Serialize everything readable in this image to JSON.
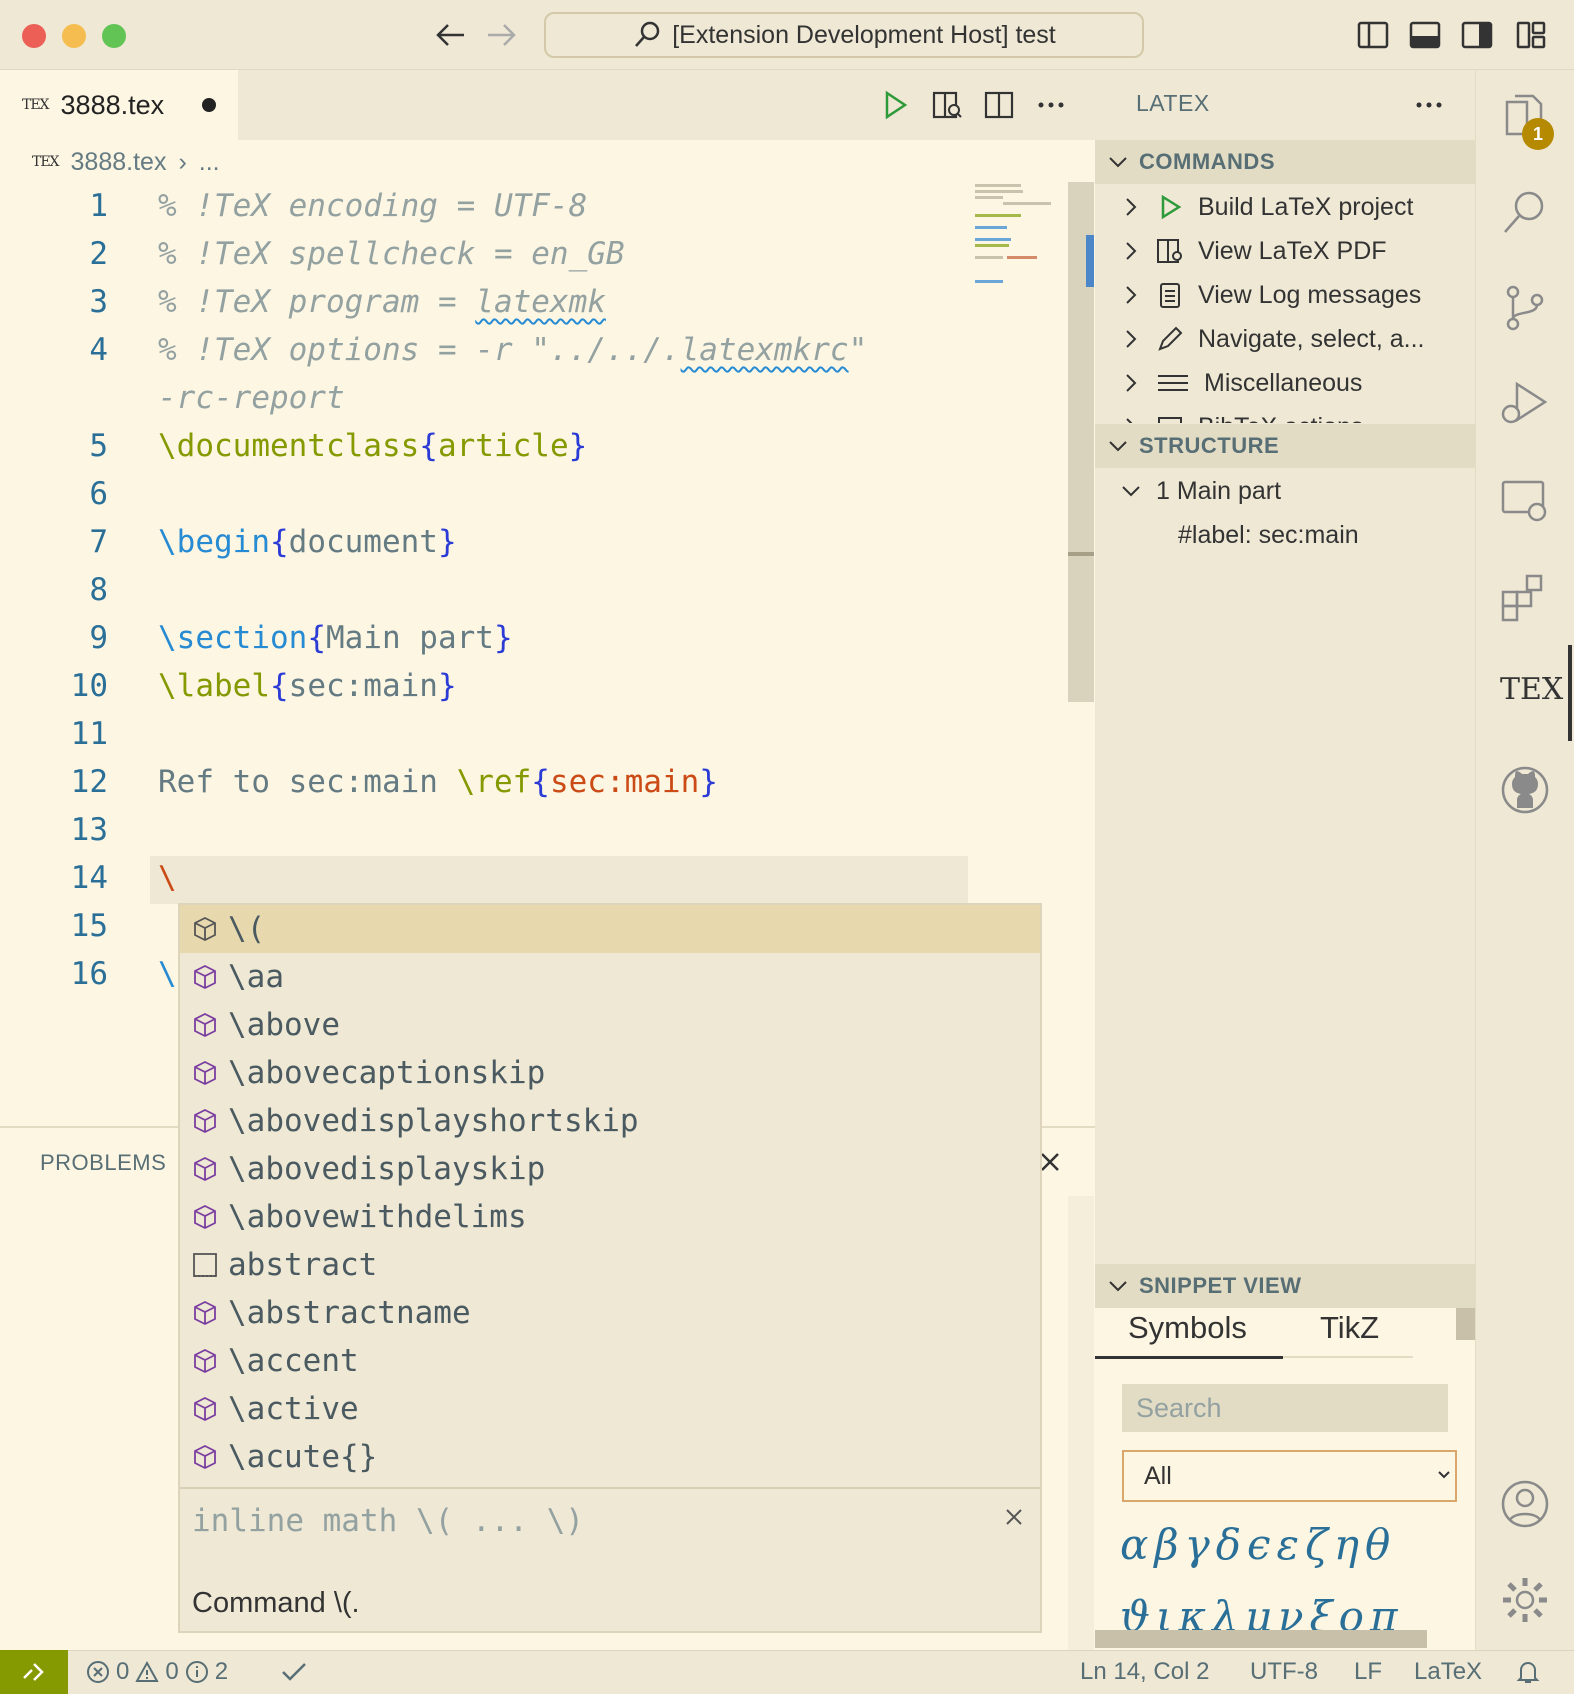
{
  "window": {
    "title": "[Extension Development Host] test"
  },
  "editor": {
    "tab": {
      "texlogo": "TEX",
      "filename": "3888.tex"
    },
    "breadcrumb": {
      "file": "3888.tex",
      "more": "..."
    },
    "lines": [
      {
        "n": "1"
      },
      {
        "n": "2"
      },
      {
        "n": "3"
      },
      {
        "n": "4"
      },
      {
        "n": "5"
      },
      {
        "n": "6"
      },
      {
        "n": "7"
      },
      {
        "n": "8"
      },
      {
        "n": "9"
      },
      {
        "n": "10"
      },
      {
        "n": "11"
      },
      {
        "n": "12"
      },
      {
        "n": "13"
      },
      {
        "n": "14"
      },
      {
        "n": "15"
      },
      {
        "n": "16"
      }
    ],
    "code": {
      "l1": "% !TeX encoding = UTF-8",
      "l2": "% !TeX spellcheck = en_GB",
      "l3a": "% !TeX program = ",
      "l3b": "latexmk",
      "l4a": "% !TeX options = -r \"../../.",
      "l4b": "latexmkrc",
      "l4c": "\"",
      "l4cont": "-rc-report",
      "l5a": "\\documentclass",
      "l5b": "{",
      "l5c": "article",
      "l5d": "}",
      "l7a": "\\begin",
      "l7b": "{",
      "l7c": "document",
      "l7d": "}",
      "l9a": "\\section",
      "l9b": "{",
      "l9c": "Main part",
      "l9d": "}",
      "l10a": "\\label",
      "l10b": "{",
      "l10c": "sec:main",
      "l10d": "}",
      "l12a": "Ref to sec:main ",
      "l12b": "\\ref",
      "l12c": "{",
      "l12d": "sec:main",
      "l12e": "}",
      "l14": "\\",
      "l16": "\\"
    }
  },
  "suggestions": {
    "items": [
      {
        "label": "\\(",
        "kind": "cube-icon"
      },
      {
        "label": "\\aa",
        "kind": "cube-icon"
      },
      {
        "label": "\\above",
        "kind": "cube-icon"
      },
      {
        "label": "\\abovecaptionskip",
        "kind": "cube-icon"
      },
      {
        "label": "\\abovedisplayshortskip",
        "kind": "cube-icon"
      },
      {
        "label": "\\abovedisplayskip",
        "kind": "cube-icon"
      },
      {
        "label": "\\abovewithdelims",
        "kind": "cube-icon"
      },
      {
        "label": "abstract",
        "kind": "snippet-icon"
      },
      {
        "label": "\\abstractname",
        "kind": "cube-icon"
      },
      {
        "label": "\\accent",
        "kind": "cube-icon"
      },
      {
        "label": "\\active",
        "kind": "cube-icon"
      },
      {
        "label": "\\acute{}",
        "kind": "cube-icon"
      }
    ],
    "detail_title": "inline math \\( ... \\)",
    "detail_doc": "Command \\(."
  },
  "panel": {
    "title": "PROBLEMS"
  },
  "sidebar": {
    "title": "LATEX",
    "commands_header": "COMMANDS",
    "commands": [
      {
        "label": "Build LaTeX project",
        "icon": "play-icon"
      },
      {
        "label": "View LaTeX PDF",
        "icon": "pdf-preview-icon"
      },
      {
        "label": "View Log messages",
        "icon": "log-icon"
      },
      {
        "label": "Navigate, select, a...",
        "icon": "pencil-icon"
      },
      {
        "label": "Miscellaneous",
        "icon": "menu-lines-icon"
      },
      {
        "label": "BibTeX actions",
        "icon": "bibtex-icon"
      }
    ],
    "structure_header": "STRUCTURE",
    "structure": {
      "section": "1 Main part",
      "label": "#label: sec:main"
    },
    "snippet_header": "SNIPPET VIEW",
    "snippet_tabs": [
      "Symbols",
      "TikZ"
    ],
    "search_placeholder": "Search",
    "category": "All",
    "symbols_row1": "αβγδϵεζηθ",
    "symbols_row2": "ϑικλμνξοπ"
  },
  "activity": {
    "explorer_badge": "1",
    "tex_label": "TEX"
  },
  "status": {
    "errors": "0",
    "warnings": "0",
    "infos": "2",
    "position": "Ln 14, Col 2",
    "encoding": "UTF-8",
    "eol": "LF",
    "language": "LaTeX"
  },
  "colors": {
    "background": "#fdf6e3",
    "chrome": "#eee8d5",
    "accent_blue": "#268bd2",
    "accent_green": "#859900",
    "accent_orange": "#cb4b16",
    "badge": "#b58900"
  }
}
